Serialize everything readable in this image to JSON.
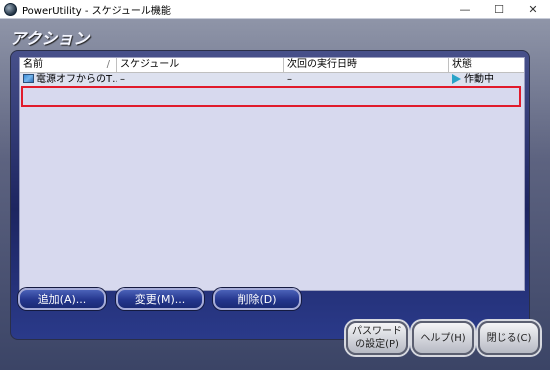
{
  "window": {
    "title": "PowerUtility - スケジュール機能",
    "minimize": "—",
    "maximize": "☐",
    "close": "✕"
  },
  "panel": {
    "title": "アクション"
  },
  "list": {
    "columns": [
      "名前",
      "スケジュール",
      "次回の実行日時",
      "状態"
    ],
    "sort_indicator": "/",
    "rows": [
      {
        "name": "電源オフからのT…",
        "schedule": "–",
        "next_run": "–",
        "status": "作動中"
      }
    ]
  },
  "buttons": {
    "add": "追加(A)...",
    "edit": "変更(M)...",
    "delete": "削除(D)",
    "password_line1": "パスワード",
    "password_line2": "の設定(P)",
    "help": "ヘルプ(H)",
    "close": "閉じる(C)"
  }
}
